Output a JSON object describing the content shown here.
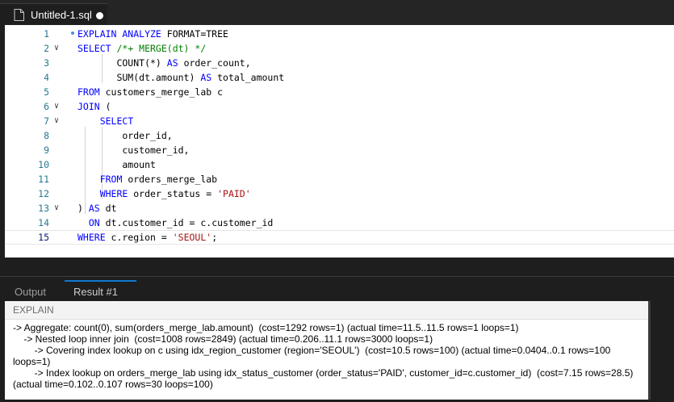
{
  "editor_tab": {
    "title": "Untitled-1.sql",
    "dirty": true
  },
  "editor": {
    "current_line": 15,
    "lines": [
      {
        "n": "1",
        "fold": false,
        "tokens": [
          [
            "kw",
            "EXPLAIN ANALYZE "
          ],
          [
            "t",
            "FORMAT=TREE"
          ]
        ]
      },
      {
        "n": "2",
        "fold": true,
        "tokens": [
          [
            "kw",
            "SELECT "
          ],
          [
            "cm",
            "/*+ MERGE(dt) */"
          ]
        ]
      },
      {
        "n": "3",
        "fold": false,
        "tokens": [
          [
            "t",
            "       COUNT(*) "
          ],
          [
            "kw",
            "AS "
          ],
          [
            "t",
            "order_count,"
          ]
        ]
      },
      {
        "n": "4",
        "fold": false,
        "tokens": [
          [
            "t",
            "       SUM(dt.amount) "
          ],
          [
            "kw",
            "AS "
          ],
          [
            "t",
            "total_amount"
          ]
        ]
      },
      {
        "n": "5",
        "fold": false,
        "tokens": [
          [
            "kw",
            "FROM "
          ],
          [
            "t",
            "customers_merge_lab c"
          ]
        ]
      },
      {
        "n": "6",
        "fold": true,
        "tokens": [
          [
            "kw",
            "JOIN "
          ],
          [
            "t",
            "("
          ]
        ]
      },
      {
        "n": "7",
        "fold": true,
        "tokens": [
          [
            "t",
            "    "
          ],
          [
            "kw",
            "SELECT"
          ]
        ]
      },
      {
        "n": "8",
        "fold": false,
        "tokens": [
          [
            "t",
            "        order_id,"
          ]
        ]
      },
      {
        "n": "9",
        "fold": false,
        "tokens": [
          [
            "t",
            "        customer_id,"
          ]
        ]
      },
      {
        "n": "10",
        "fold": false,
        "tokens": [
          [
            "t",
            "        amount"
          ]
        ]
      },
      {
        "n": "11",
        "fold": false,
        "tokens": [
          [
            "t",
            "    "
          ],
          [
            "kw",
            "FROM "
          ],
          [
            "t",
            "orders_merge_lab"
          ]
        ]
      },
      {
        "n": "12",
        "fold": false,
        "tokens": [
          [
            "t",
            "    "
          ],
          [
            "kw",
            "WHERE "
          ],
          [
            "t",
            "order_status = "
          ],
          [
            "st",
            "'PAID'"
          ]
        ]
      },
      {
        "n": "13",
        "fold": true,
        "tokens": [
          [
            "t",
            ") "
          ],
          [
            "kw",
            "AS "
          ],
          [
            "t",
            "dt"
          ]
        ]
      },
      {
        "n": "14",
        "fold": false,
        "tokens": [
          [
            "t",
            "  "
          ],
          [
            "kw",
            "ON "
          ],
          [
            "t",
            "dt.customer_id = c.customer_id"
          ]
        ]
      },
      {
        "n": "15",
        "fold": false,
        "tokens": [
          [
            "kw",
            "WHERE "
          ],
          [
            "t",
            "c.region = "
          ],
          [
            "st",
            "'SEOUL'"
          ],
          [
            "t",
            ";"
          ]
        ]
      }
    ]
  },
  "panel": {
    "tabs": [
      {
        "label": "Output",
        "active": false
      },
      {
        "label": "Result #1",
        "active": true
      }
    ],
    "column_header": "EXPLAIN",
    "plan_lines": [
      "-> Aggregate: count(0), sum(orders_merge_lab.amount)  (cost=1292 rows=1) (actual time=11.5..11.5 rows=1 loops=1)",
      "    -> Nested loop inner join  (cost=1008 rows=2849) (actual time=0.206..11.1 rows=3000 loops=1)",
      "        -> Covering index lookup on c using idx_region_customer (region='SEOUL')  (cost=10.5 rows=100) (actual time=0.0404..0.1 rows=100 loops=1)",
      "        -> Index lookup on orders_merge_lab using idx_status_customer (order_status='PAID', customer_id=c.customer_id)  (cost=7.15 rows=28.5) (actual time=0.102..0.107 rows=30 loops=100)"
    ]
  },
  "colors": {
    "accent": "#0e7ad1",
    "keyword": "#0000ff",
    "comment": "#008000",
    "string": "#a31515",
    "line_number": "#237893"
  }
}
